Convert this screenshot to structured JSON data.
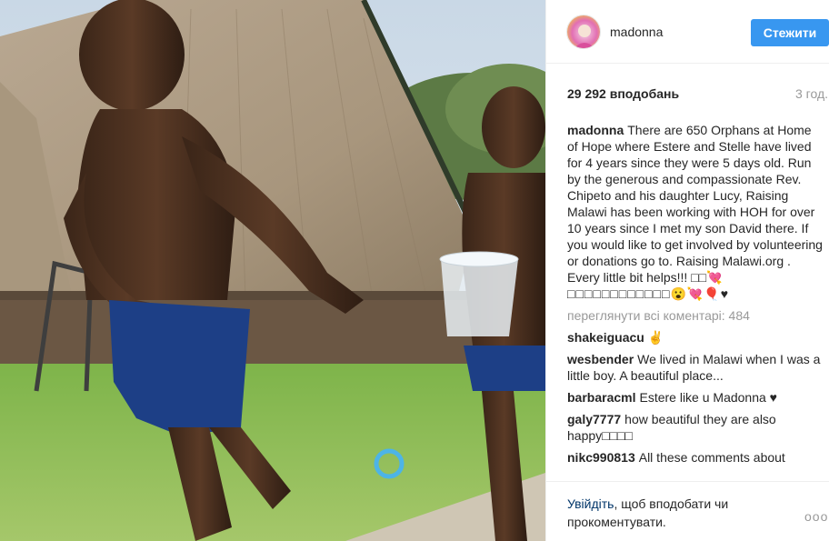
{
  "post": {
    "username": "madonna",
    "follow_label": "Стежити",
    "likes": "29 292 вподобань",
    "time_ago": "3 год.",
    "caption_user": "madonna",
    "caption_text": "There are 650 Orphans at Home of Hope where Estere and Stelle have lived for 4 years since they were 5 days old. Run by the generous and compassionate Rev. Chipeto and his daughter Lucy, Raising Malawi has been working with HOH for over 10 years since I met my son David there. If you would like to get involved by volunteering or donations go to. Raising Malawi.org . Every little bit helps!!! □□💘",
    "caption_emojis": "□□□□□□□□□□□□😮💘🎈♥",
    "view_all_comments": "переглянути всі коментарі: 484",
    "comments": [
      {
        "user": "shakeiguacu",
        "text": "✌"
      },
      {
        "user": "wesbender",
        "text": "We lived in Malawi when I was a little boy. A beautiful place..."
      },
      {
        "user": "barbaracml",
        "text": "Estere like u Madonna ♥"
      },
      {
        "user": "galy7777",
        "text": "how beautiful they are also happy□□□□"
      },
      {
        "user": "nikc990813",
        "text": "All these comments about"
      }
    ]
  },
  "footer": {
    "login_link": "Увійдіть",
    "login_text": ", щоб вподобати чи прокоментувати.",
    "more_glyph": "ooo"
  },
  "colors": {
    "accent": "#3897f0",
    "link": "#003569",
    "muted": "#999999"
  }
}
